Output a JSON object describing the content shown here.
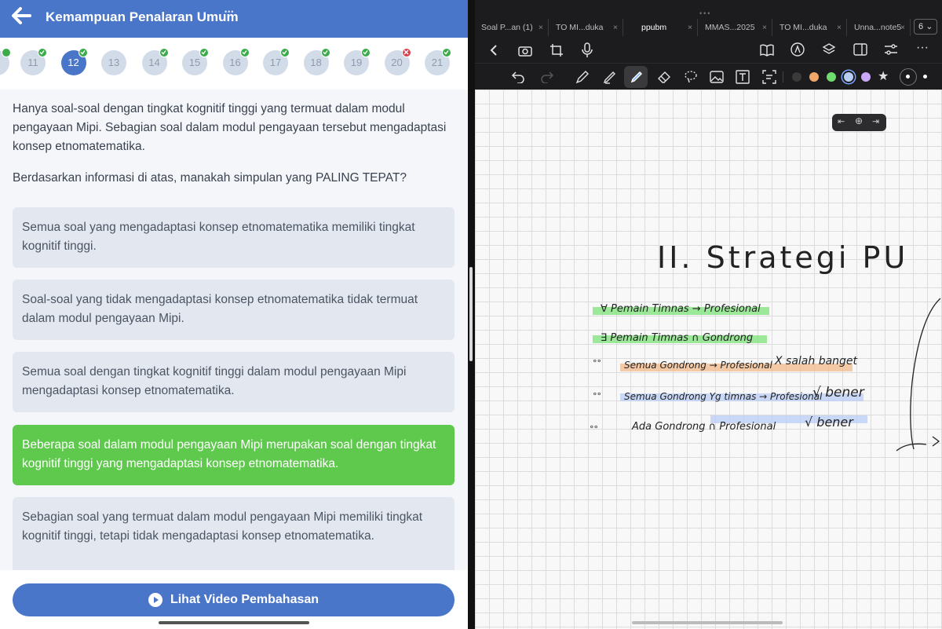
{
  "left_app": {
    "header_title": "Kemampuan Penalaran Umum",
    "header_dots": "•••",
    "questions": [
      {
        "n": "11",
        "status": "correct"
      },
      {
        "n": "12",
        "status": "current"
      },
      {
        "n": "13",
        "status": "none"
      },
      {
        "n": "14",
        "status": "correct"
      },
      {
        "n": "15",
        "status": "correct"
      },
      {
        "n": "16",
        "status": "correct"
      },
      {
        "n": "17",
        "status": "correct"
      },
      {
        "n": "18",
        "status": "correct"
      },
      {
        "n": "19",
        "status": "correct"
      },
      {
        "n": "20",
        "status": "wrong"
      },
      {
        "n": "21",
        "status": "correct"
      }
    ],
    "premise": "Hanya soal-soal dengan tingkat kognitif tinggi yang termuat dalam modul pengayaan Mipi. Sebagian soal dalam modul pengayaan tersebut mengadaptasi konsep etnomatematika.",
    "prompt": "Berdasarkan informasi di atas, manakah simpulan yang PALING TEPAT?",
    "options": [
      "Semua soal yang mengadaptasi konsep etnomatematika memiliki tingkat kognitif tinggi.",
      "Soal-soal yang tidak mengadaptasi konsep etnomatematika tidak termuat dalam modul pengayaan Mipi.",
      "Semua soal dengan tingkat kognitif tinggi dalam modul pengayaan Mipi mengadaptasi konsep etnomatematika.",
      "Beberapa soal dalam modul pengayaan Mipi merupakan soal dengan tingkat kognitif tinggi yang mengadaptasi konsep etnomatematika.",
      "Sebagian soal yang termuat dalam modul pengayaan Mipi memiliki tingkat kognitif tinggi, tetapi tidak mengadaptasi konsep etnomatematika."
    ],
    "correct_option_index": 3,
    "video_button": "Lihat Video Pembahasan"
  },
  "right_app": {
    "tabs": [
      "Soal P...an (1)",
      "TO MI...duka",
      "ppubm",
      "MMAS...2025",
      "TO MI...duka",
      "Unna...note5"
    ],
    "active_tab_index": 2,
    "tab_count": "6",
    "swatch_colors": [
      "#3a3a3a",
      "#f0a86a",
      "#6fdc6f",
      "#b9cef5",
      "#c9a8f5"
    ],
    "notes": {
      "heading": "II. Strategi PU",
      "line1": "∀ Pemain Timnas → Profesional",
      "line2": "∃ Pemain Timnas ∩ Gondrong",
      "line3": "Semua Gondrong → Profesional",
      "line3_mark": "X salah banget",
      "line4": "Semua Gondrong Yg timnas → Profesional",
      "line4_mark": "√ bener",
      "line5": "Ada Gondrong ∩ Profesional",
      "line5_mark": "√ bener"
    }
  },
  "colors": {
    "primary": "#4a76c9",
    "correct": "#5fc94d",
    "wrong": "#d9404f",
    "check": "#3dab4b"
  }
}
